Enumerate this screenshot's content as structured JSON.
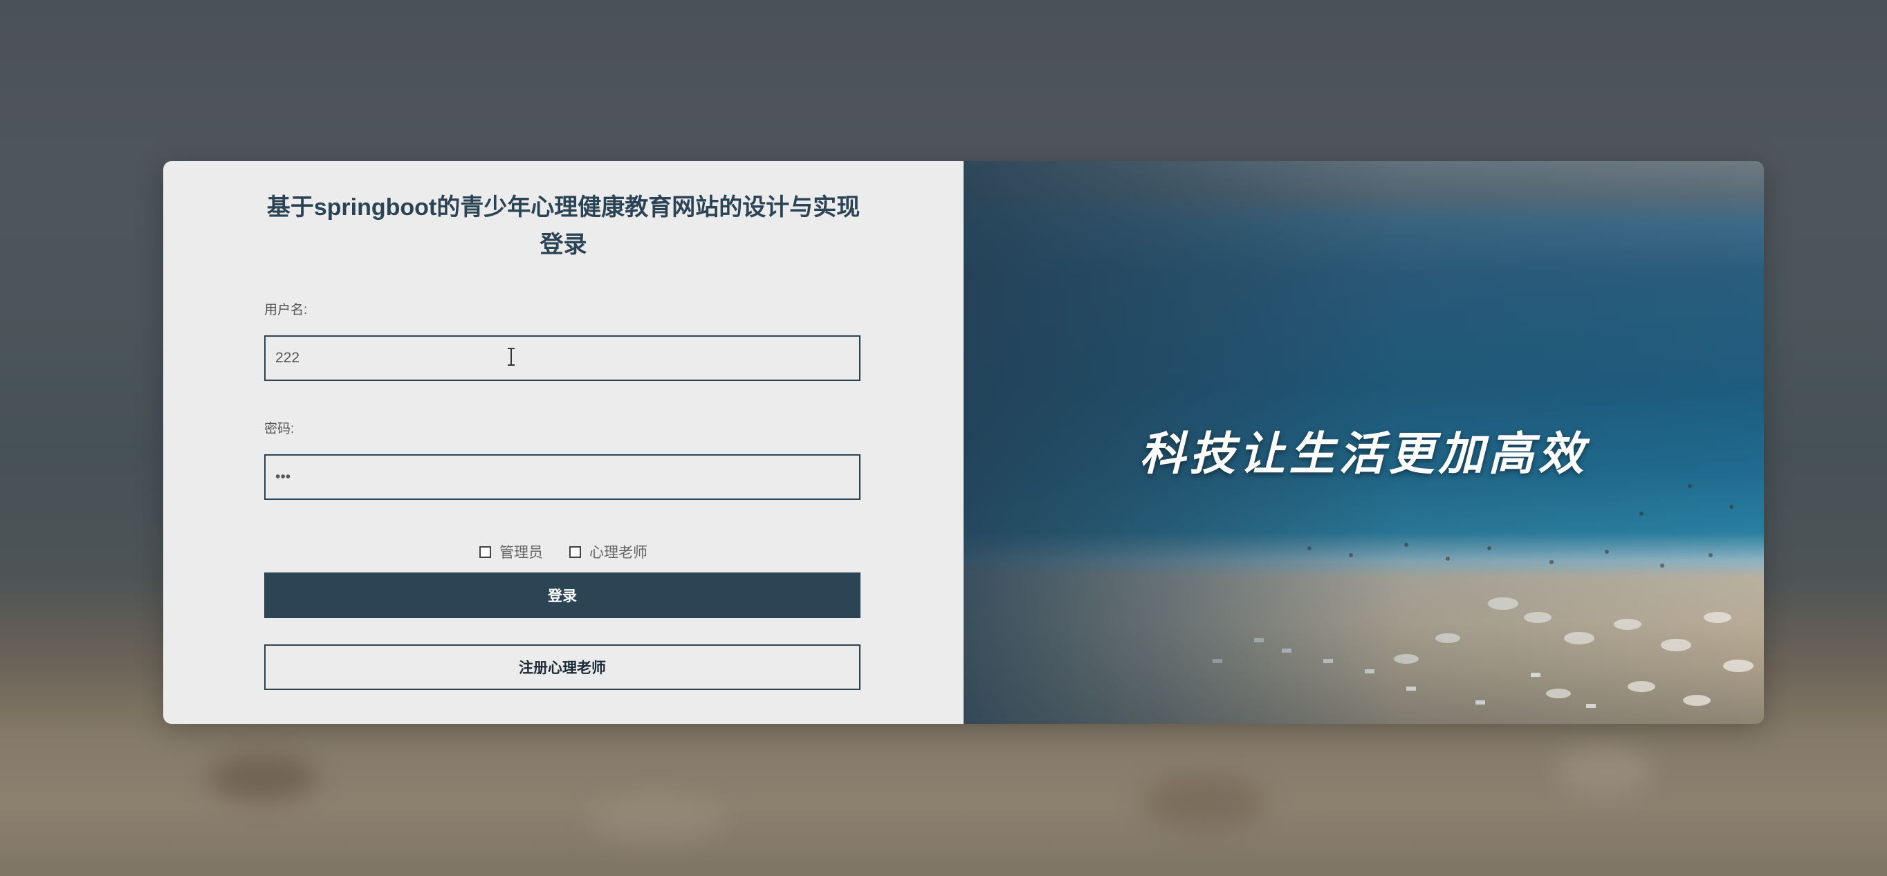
{
  "header": {
    "title_line1": "基于springboot的青少年心理健康教育网站的设计与实现",
    "title_line2": "登录"
  },
  "form": {
    "username_label": "用户名:",
    "username_value": "222",
    "password_label": "密码:",
    "password_value": "123"
  },
  "roles": [
    {
      "label": "管理员",
      "checked": false
    },
    {
      "label": "心理老师",
      "checked": false
    }
  ],
  "buttons": {
    "login_label": "登录",
    "register_label": "注册心理老师"
  },
  "banner": {
    "slogan": "科技让生活更加高效"
  },
  "colors": {
    "primary": "#2b4555",
    "panel_bg": "#ececec"
  }
}
